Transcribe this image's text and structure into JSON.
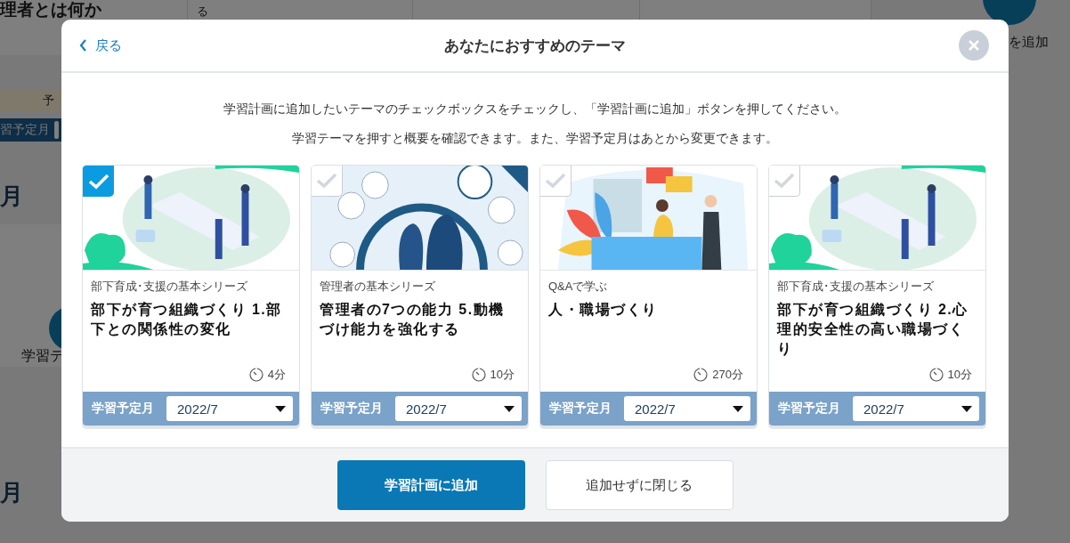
{
  "background": {
    "top_title": "理者とは何か",
    "top_description": "る",
    "add_label": "を追加",
    "plan_label": "予",
    "month_label": "習予定月",
    "month_heading_1": "月",
    "theme_label": "学習テ",
    "month_heading_2": "月"
  },
  "dialog": {
    "back": "戻る",
    "title": "あなたにおすすめのテーマ",
    "instructions": [
      "学習計画に追加したいテーマのチェックボックスをチェックし、「学習計画に追加」ボタンを押してください。",
      "学習テーマを押すと概要を確認できます。また、学習予定月はあとから変更できます。"
    ],
    "cards": [
      {
        "selected": true,
        "series": "部下育成･支援の基本シリーズ",
        "title": "部下が育つ組織づくり 1.部下との関係性の変化",
        "duration": "4分",
        "month_label": "学習予定月",
        "month": "2022/7"
      },
      {
        "selected": false,
        "series": "管理者の基本シリーズ",
        "title": "管理者の7つの能力 5.動機づけ能力を強化する",
        "duration": "10分",
        "month_label": "学習予定月",
        "month": "2022/7"
      },
      {
        "selected": false,
        "series": "Q&Aで学ぶ",
        "title": "人・職場づくり",
        "duration": "270分",
        "month_label": "学習予定月",
        "month": "2022/7"
      },
      {
        "selected": false,
        "series": "部下育成･支援の基本シリーズ",
        "title": "部下が育つ組織づくり 2.心理的安全性の高い職場づくり",
        "duration": "10分",
        "month_label": "学習予定月",
        "month": "2022/7"
      }
    ],
    "buttons": [
      {
        "label": "学習計画に追加",
        "kind": "primary"
      },
      {
        "label": "追加せずに閉じる",
        "kind": "secondary"
      }
    ]
  }
}
